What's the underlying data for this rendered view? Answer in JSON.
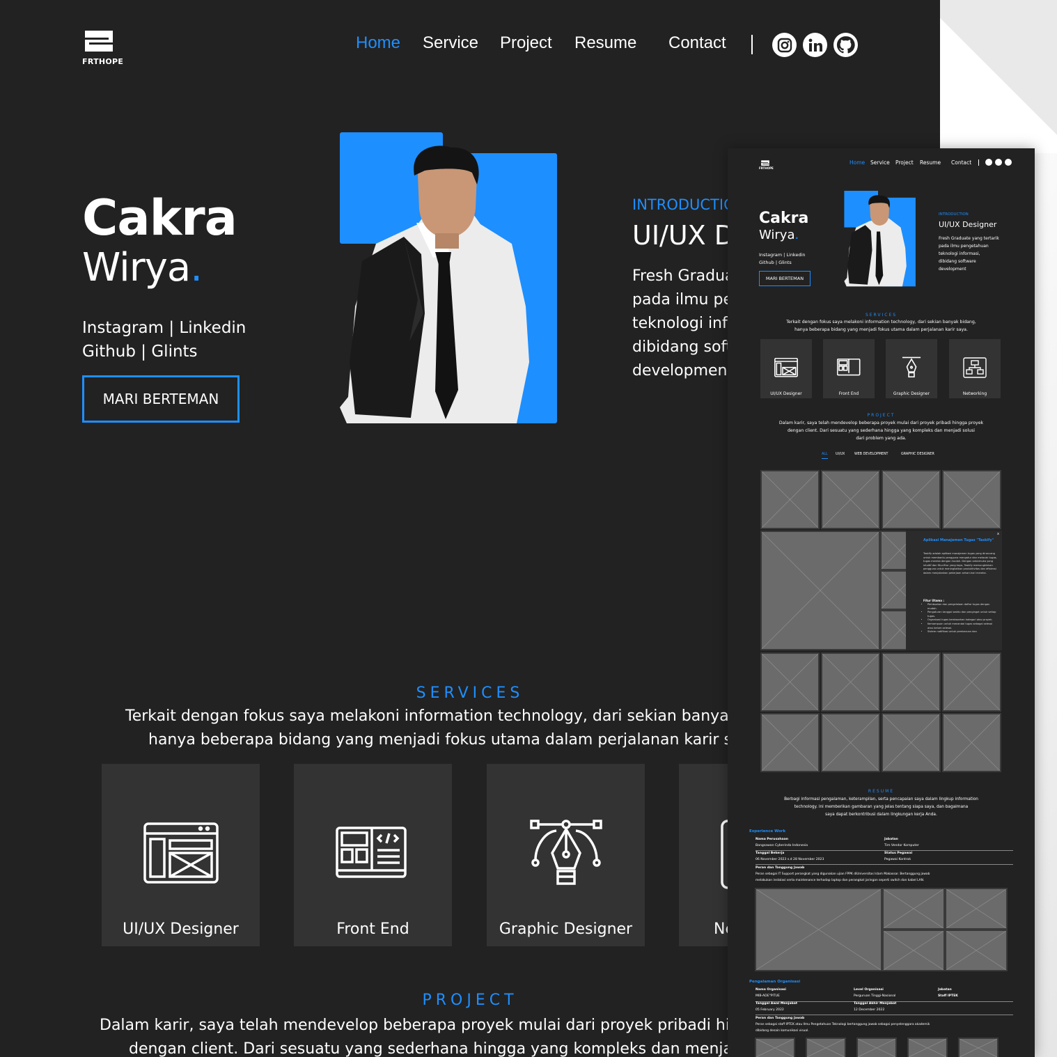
{
  "brand": {
    "logo_text": "FRTHOPE"
  },
  "nav": {
    "items": [
      "Home",
      "Service",
      "Project",
      "Resume",
      "Contact"
    ],
    "active": "Home"
  },
  "social": [
    "instagram-icon",
    "linkedin-icon",
    "github-icon"
  ],
  "hero": {
    "first_name": "Cakra",
    "last_name": "Wirya",
    "dot": ".",
    "links_line1": "Instagram | Linkedin",
    "links_line2": "Github | Glints",
    "cta": "MARI BERTEMAN"
  },
  "intro": {
    "label": "INTRODUCTION",
    "title": "UI/UX Designer",
    "desc": "Fresh Graduate yang tertarik\npada ilmu pengetahuan\nteknologi informasi,\ndibidang software\ndevelopment"
  },
  "services": {
    "title": "SERVICES",
    "desc_line1": "Terkait dengan fokus saya melakoni information technology, dari sekian banyak bidang,",
    "desc_line2": "hanya beberapa bidang yang menjadi fokus utama dalam perjalanan karir saya.",
    "items": [
      "UI/UX Designer",
      "Front End",
      "Graphic Designer",
      "Networking"
    ]
  },
  "project": {
    "title": "PROJECT",
    "desc_line1": "Dalam karir, saya telah mendevelop beberapa proyek mulai dari proyek pribadi hingga proyek",
    "desc_line2": "dengan client. Dari sesuatu yang sederhana hingga yang kompleks dan menjadi solusi",
    "desc_line3": "dari problem yang ada.",
    "filters": [
      "ALL",
      "UI/UX",
      "WEB DEVELOPMENT",
      "GRAPHIC DESIGNER"
    ]
  },
  "popup": {
    "close": "x",
    "title": "Aplikasi Manajemen Tugas \"Taskify\"",
    "desc": "Taskify adalah aplikasi manajemen tugas yang dirancang untuk membantu pengguna mengatur dan melacak tugas-tugas mereka dengan mudah. Dengan antarmuka yang intuitif dan fitur-fitur yang kaya, Taskify memungkinkan pengguna untuk meningkatkan produktivitas dan efisiensi dalam menjalankan pekerjaan sehari-hari mereka.",
    "features_title": "Fitur Utama :",
    "features": [
      "Pembuatan dan pengelolaan daftar tugas dengan mudah.",
      "Pengaturan tanggal waktu dan pengingat untuk setiap tugas.",
      "Organisasi tugas berdasarkan kategori atau proyek.",
      "Kemampuan untuk menandai tugas sebagai selesai atau belum selesai.",
      "Sistem notifikasi untuk pembaruan dan"
    ]
  },
  "resume": {
    "title": "RESUME",
    "desc_line1": "Berbagi informasi pengalaman, keterampilan, serta pencapaian saya dalam lingkup information",
    "desc_line2": "technology. ini memberikan gambaran yang jelas tentang siapa saya, dan bagaimana",
    "desc_line3": "saya dapat berkontribusi dalam lingkungan kerja Anda.",
    "experience": {
      "heading": "Experience Work",
      "company_label": "Nama Perusahaan",
      "company": "Bangsawan Cyberindo Indonesia",
      "position_label": "Jabatan",
      "position": "Tim Vendor Komputer",
      "date_label": "Tanggal Bekerja",
      "date": "06 November 2023 s.d 28 November 2023",
      "status_label": "Status Pegawai",
      "status": "Pegawai Kontrak",
      "role_label": "Peran dan Tanggung Jawab",
      "role_line1": "Peran sebagai IT Support perangkat yang digunakan ujian FPPK diUniversitas Islam Makassar. Bertanggung jawab",
      "role_line2": "melakukan instalasi serta maintenance terhadap laptop dan perangkat jaringan seperti switch dan kabel LAN."
    },
    "organization": {
      "heading": "Pengalaman Organisasi",
      "org_label": "Nama Organisasi",
      "org": "MIB-ADE\"PITUE",
      "level_label": "Level Organisasi",
      "level": "Perguruan Tinggi-Nasional",
      "position_label": "Jabatan",
      "position": "Staff IPTEK",
      "start_label": "Tanggal Awal Menjabat",
      "start": "05 February 2022",
      "end_label": "Tanggal Akhir Menjabat",
      "end": "12 December 2022",
      "role_label": "Peran dan Tanggung Jawab",
      "role_line1": "Peran sebagai staff IPTEK atau Ilmu Pengetahuan Teknologi bertanggung jawab sebagai penyelenggara akademik",
      "role_line2": "dibidang desain komunikasi visual."
    }
  },
  "colors": {
    "accent": "#1e8fff",
    "background": "#222222",
    "card": "#333333",
    "placeholder": "#6b6b6b"
  }
}
